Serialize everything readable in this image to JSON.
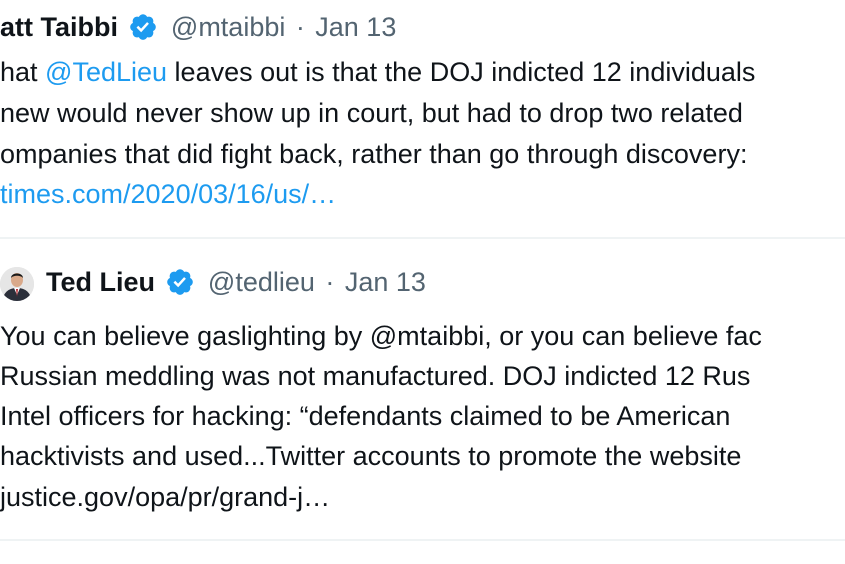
{
  "tweet1": {
    "name": "att Taibbi",
    "handle": "@mtaibbi",
    "separator": "·",
    "date": "Jan 13",
    "line1_before": "hat ",
    "line1_mention": "@TedLieu",
    "line1_after": " leaves out is that the DOJ indicted 12 individuals",
    "line2": "new would never show up in court, but had to drop two related",
    "line3": "ompanies that did fight back, rather than go through discovery:",
    "link": "times.com/2020/03/16/us/…"
  },
  "tweet2": {
    "name": "Ted Lieu",
    "handle": "@tedlieu",
    "separator": "·",
    "date": "Jan 13",
    "line1": "You can believe gaslighting by @mtaibbi, or you can believe fac",
    "line2": "Russian meddling was not manufactured. DOJ indicted 12 Rus",
    "line3": "Intel officers for hacking: “defendants claimed to be American",
    "line4": "hacktivists and used...Twitter accounts to promote the website",
    "line5": "justice.gov/opa/pr/grand-j…"
  },
  "colors": {
    "text": "#0f1419",
    "secondary": "#536471",
    "link": "#1d9bf0",
    "verified": "#1d9bf0",
    "divider": "#eff3f4"
  }
}
